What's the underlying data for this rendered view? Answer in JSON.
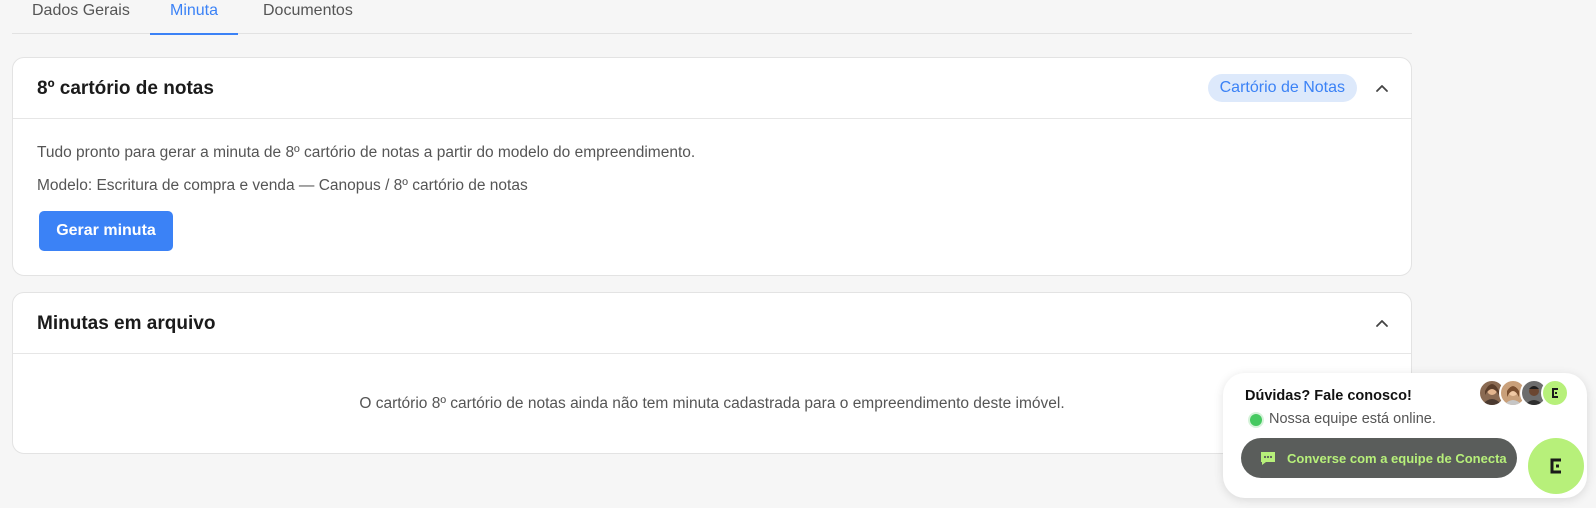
{
  "tabs": [
    {
      "label": "Dados Gerais"
    },
    {
      "label": "Minuta"
    },
    {
      "label": "Documentos"
    }
  ],
  "active_tab": "Minuta",
  "accent_color": "#3b82f6",
  "card_generate": {
    "title": "8º cartório de notas",
    "badge": "Cartório de Notas",
    "description": "Tudo pronto para gerar a minuta de 8º cartório de notas a partir do modelo do empreendimento.",
    "model": "Modelo: Escritura de compra e venda — Canopus / 8º cartório de notas",
    "button_label": "Gerar minuta",
    "toggle_icon": "chevron-up-icon"
  },
  "card_archive": {
    "title": "Minutas em arquivo",
    "empty_message": "O cartório 8º cartório de notas ainda não tem minuta cadastrada para o empreendimento deste imóvel.",
    "toggle_icon": "chevron-up-icon"
  },
  "chat_widget": {
    "title": "Dúvidas? Fale conosco!",
    "status": "Nossa equipe está online.",
    "button_label": "Converse com a equipe de Conecta",
    "button_icon": "chat-bubble-icon",
    "launcher_icon": "conecta-logo-icon",
    "brand_color": "#b7f07a"
  }
}
